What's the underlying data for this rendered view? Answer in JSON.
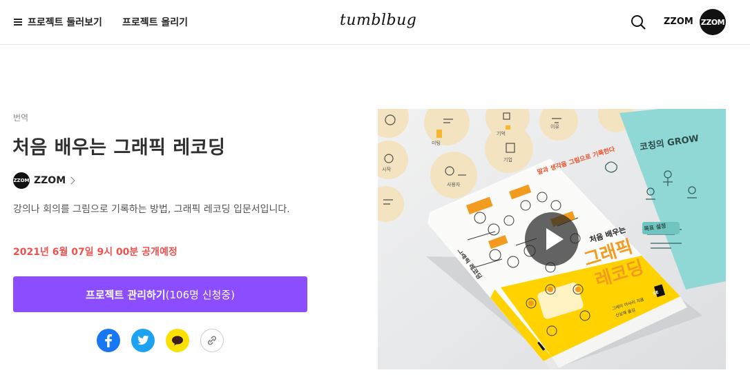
{
  "header": {
    "browse_label": "프로젝트 둘러보기",
    "upload_label": "프로젝트 올리기",
    "logo": "tumblbug",
    "user_name": "ZZOM",
    "user_avatar_text": "ZZOM"
  },
  "project": {
    "category": "번역",
    "title": "처음 배우는 그래픽 레코딩",
    "creator_name": "ZZOM",
    "creator_avatar_text": "ZZOM",
    "description": "강의나 회의를 그림으로 기록하는 방법, 그래픽 레코딩 입문서입니다.",
    "schedule": "2021년 6월 07일 9시 00분 공개예정",
    "cta_main": "프로젝트 관리하기",
    "cta_count": "(106명 신청중)"
  },
  "media": {
    "book_banner": "말과 생각을 그림으로 기록한다",
    "book_subtitle": "처음 배우는",
    "book_title_1": "그래픽",
    "book_title_2": "레코딩",
    "book_author": "그레이 아사리 지음",
    "book_translator": "신상재 옮김",
    "publisher_mark": "SE",
    "spine_title": "그래픽 레코딩",
    "teal_heading": "코칭의 GROW",
    "teal_label": "목표 설정",
    "cream_labels": [
      "미팅",
      "기억",
      "이유",
      "시작",
      "사용자",
      "기업"
    ]
  },
  "colors": {
    "accent": "#8b4dff",
    "schedule": "#f0504e",
    "facebook": "#1877f2",
    "twitter": "#1da1f2",
    "kakao": "#fae100",
    "book_yellow": "#ffd200",
    "book_orange": "#f39b1e",
    "teal": "#8fd8d5"
  },
  "icons": {
    "menu": "hamburger-icon",
    "search": "search-icon",
    "creator_link": "chevron-right-icon",
    "share": [
      "facebook-icon",
      "twitter-icon",
      "kakaotalk-icon",
      "link-icon"
    ],
    "video": "play-icon"
  }
}
